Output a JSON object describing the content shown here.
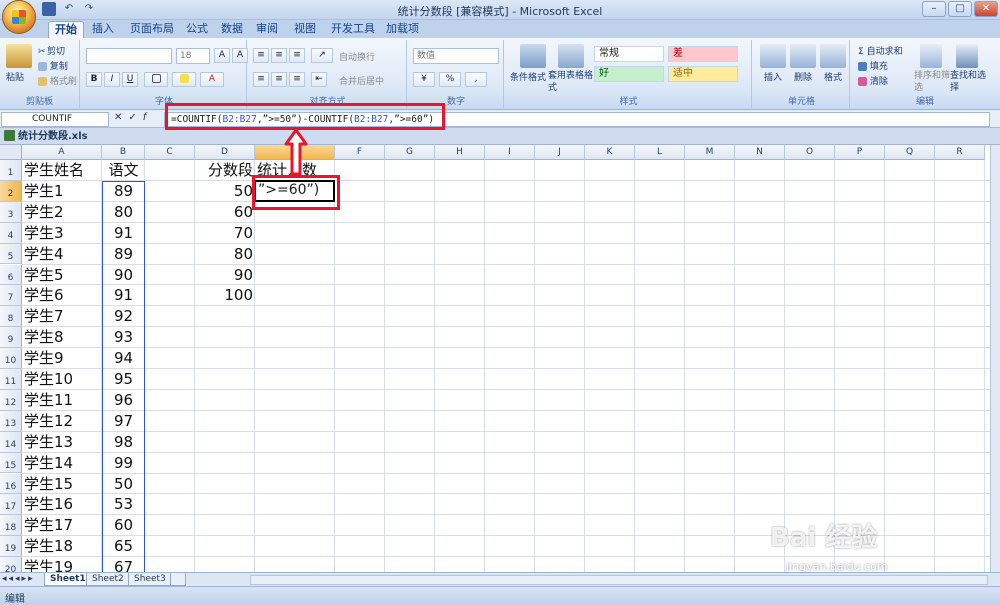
{
  "window": {
    "title": "统计分数段  [兼容模式] - Microsoft Excel"
  },
  "tabs": [
    {
      "label": "开始",
      "active": true
    },
    {
      "label": "插入"
    },
    {
      "label": "页面布局"
    },
    {
      "label": "公式"
    },
    {
      "label": "数据"
    },
    {
      "label": "审阅"
    },
    {
      "label": "视图"
    },
    {
      "label": "开发工具"
    },
    {
      "label": "加载项"
    }
  ],
  "ribbon": {
    "clipboard": {
      "paste": "粘贴",
      "cut": "剪切",
      "copy": "复制",
      "format_painter": "格式刷",
      "group": "剪贴板"
    },
    "font": {
      "size": "18",
      "bold": "B",
      "italic": "I",
      "underline": "U",
      "group": "字体"
    },
    "alignment": {
      "wrap": "自动换行",
      "merge": "合并后居中",
      "group": "对齐方式"
    },
    "number": {
      "format": "数值",
      "percent": "%",
      "group": "数字"
    },
    "styles": {
      "conditional": "条件格式",
      "table": "套用表格格式",
      "normal": "常规",
      "bad": "差",
      "good": "好",
      "neutral": "适中",
      "group": "样式"
    },
    "cells": {
      "insert": "插入",
      "delete": "删除",
      "format": "格式",
      "group": "单元格"
    },
    "editing": {
      "autosum": "自动求和",
      "fill": "填充",
      "clear": "清除",
      "sort": "排序和筛选",
      "find": "查找和选择",
      "group": "编辑"
    }
  },
  "formula_bar": {
    "name_box": "COUNTIF",
    "formula_parts": [
      "=COUNTIF(",
      "B2:B27",
      ",”>=50”)-COUNTIF(",
      "B2:B27",
      ",”>=60”)"
    ]
  },
  "workbook": {
    "title": "统计分数段.xls"
  },
  "columns": [
    "A",
    "B",
    "C",
    "D",
    "E",
    "F",
    "G",
    "H",
    "I",
    "J",
    "K",
    "L",
    "M",
    "N",
    "O",
    "P",
    "Q",
    "R"
  ],
  "headers": {
    "a1": "学生姓名",
    "b1": "语文",
    "d1": "分数段",
    "e1": "统计人数"
  },
  "students": [
    "学生1",
    "学生2",
    "学生3",
    "学生4",
    "学生5",
    "学生6",
    "学生7",
    "学生8",
    "学生9",
    "学生10",
    "学生11",
    "学生12",
    "学生13",
    "学生14",
    "学生15",
    "学生16",
    "学生17",
    "学生18",
    "学生19"
  ],
  "scores": [
    "89",
    "80",
    "91",
    "89",
    "90",
    "91",
    "92",
    "93",
    "94",
    "95",
    "96",
    "97",
    "98",
    "99",
    "50",
    "53",
    "60",
    "65",
    "67"
  ],
  "segments": [
    "50",
    "60",
    "70",
    "80",
    "90",
    "100"
  ],
  "active_cell": {
    "text": "”>=60”)"
  },
  "sheets": [
    {
      "label": "Sheet1",
      "active": true
    },
    {
      "label": "Sheet2"
    },
    {
      "label": "Sheet3"
    }
  ],
  "status": {
    "mode": "编辑"
  },
  "watermark": {
    "brand": "Bai 经验",
    "url": "jingyan.baidu.com"
  },
  "colors": {
    "annotation": "#e8152b",
    "ribbon": "#dde8f6",
    "accent": "#15428b"
  }
}
